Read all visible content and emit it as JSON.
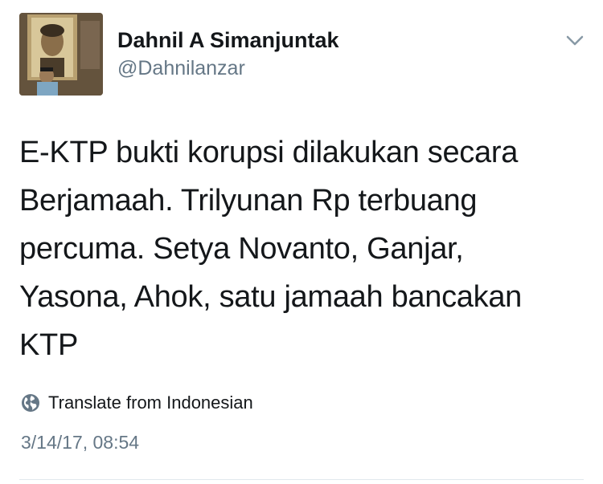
{
  "tweet": {
    "author": {
      "display_name": "Dahnil A Simanjuntak",
      "handle": "@Dahnilanzar"
    },
    "menu_icon": "chevron-down-icon",
    "text_lines": [
      "E-KTP bukti korupsi dilakukan secara",
      "Berjamaah. Trilyunan Rp terbuang",
      "percuma. Setya Novanto, Ganjar,",
      "Yasona, Ahok, satu jamaah bancakan",
      "KTP"
    ],
    "translate": {
      "icon": "globe-icon",
      "label": "Translate from Indonesian"
    },
    "timestamp": "3/14/17, 08:54"
  },
  "colors": {
    "text_primary": "#14171a",
    "text_secondary": "#657786",
    "divider": "#e1e8ed"
  }
}
